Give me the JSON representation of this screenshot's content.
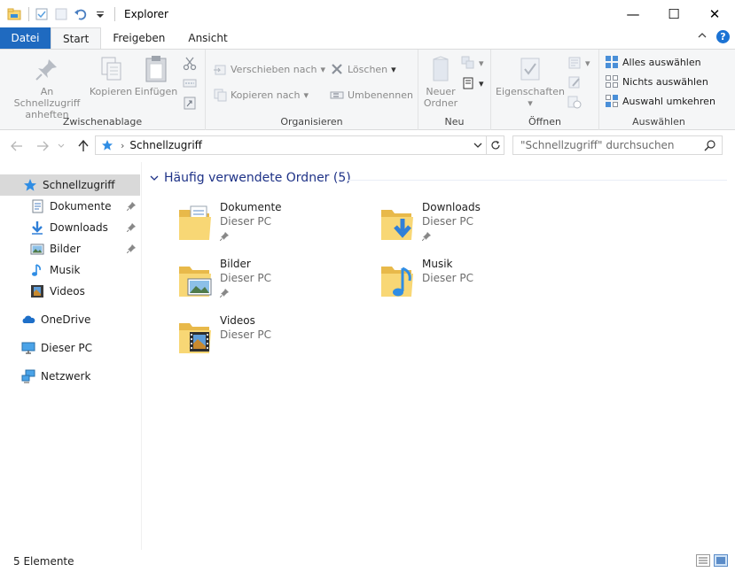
{
  "window": {
    "title": "Explorer",
    "controls": [
      "—",
      "☐",
      "✕"
    ]
  },
  "ribbon_tabs": [
    {
      "label": "Datei"
    },
    {
      "label": "Start"
    },
    {
      "label": "Freigeben"
    },
    {
      "label": "Ansicht"
    }
  ],
  "ribbon": {
    "zwischenablage": {
      "label": "Zwischenablage",
      "pin_line1": "An Schnellzugriff",
      "pin_line2": "anheften",
      "copy": "Kopieren",
      "paste": "Einfügen"
    },
    "organisieren": {
      "label": "Organisieren",
      "move": "Verschieben nach",
      "copyto": "Kopieren nach",
      "delete": "Löschen",
      "rename": "Umbenennen"
    },
    "neu": {
      "label": "Neu",
      "newfolder_line1": "Neuer",
      "newfolder_line2": "Ordner"
    },
    "oeffnen": {
      "label": "Öffnen",
      "properties": "Eigenschaften"
    },
    "auswaehlen": {
      "label": "Auswählen",
      "select_all": "Alles auswählen",
      "select_none": "Nichts auswählen",
      "invert": "Auswahl umkehren"
    }
  },
  "address": {
    "path": "Schnellzugriff",
    "search_placeholder": "\"Schnellzugriff\" durchsuchen"
  },
  "sidebar": {
    "items": [
      {
        "label": "Schnellzugriff"
      },
      {
        "label": "Dokumente"
      },
      {
        "label": "Downloads"
      },
      {
        "label": "Bilder"
      },
      {
        "label": "Musik"
      },
      {
        "label": "Videos"
      },
      {
        "label": "OneDrive"
      },
      {
        "label": "Dieser PC"
      },
      {
        "label": "Netzwerk"
      }
    ]
  },
  "main": {
    "group_title": "Häufig verwendete Ordner (5)",
    "folders": [
      {
        "name": "Dokumente",
        "location": "Dieser PC"
      },
      {
        "name": "Downloads",
        "location": "Dieser PC"
      },
      {
        "name": "Bilder",
        "location": "Dieser PC"
      },
      {
        "name": "Musik",
        "location": "Dieser PC"
      },
      {
        "name": "Videos",
        "location": "Dieser PC"
      }
    ]
  },
  "status": {
    "count": "5 Elemente"
  },
  "colors": {
    "accent": "#1f6ac0",
    "selection": "#d9d9d9",
    "folder": "#f8d775",
    "group_header": "#1e3287"
  }
}
